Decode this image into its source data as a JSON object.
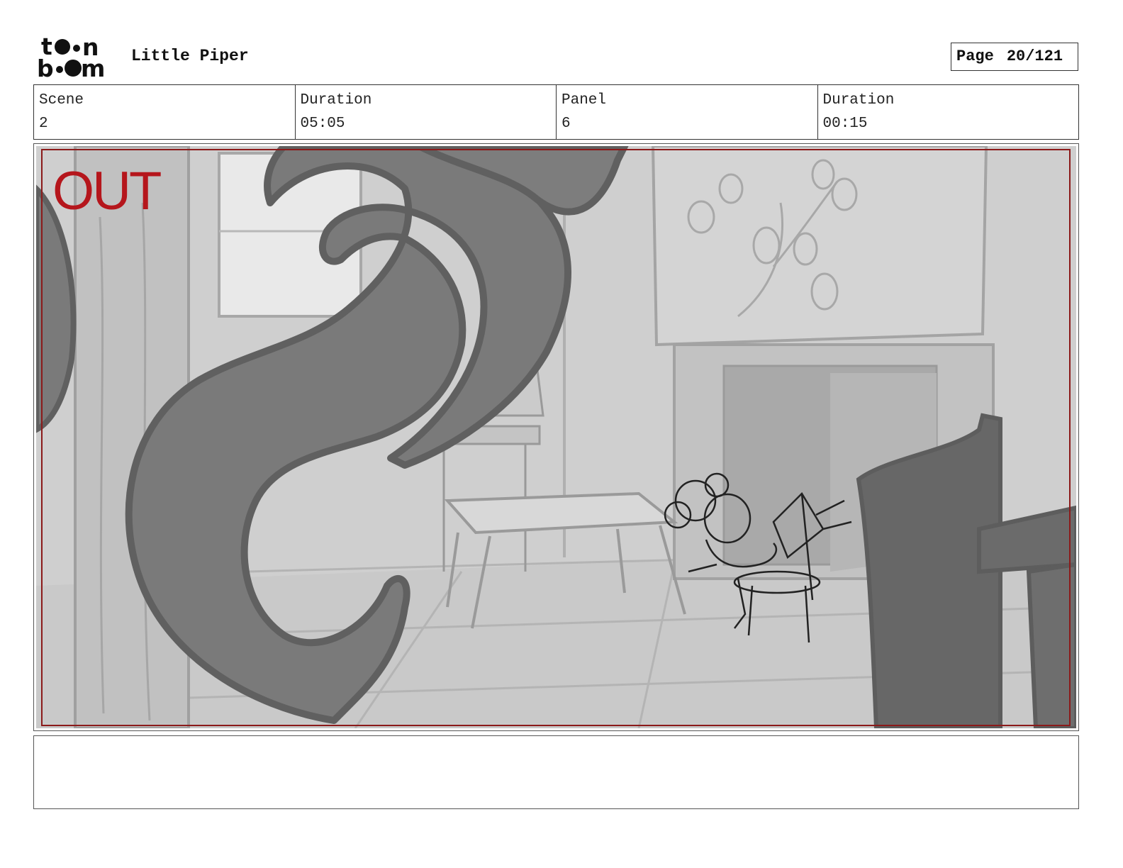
{
  "header": {
    "logo_text": "toon boom",
    "project_title": "Little Piper",
    "page_label": "Page",
    "page_number": "20/121"
  },
  "info": {
    "scene_label": "Scene",
    "scene_value": "2",
    "scene_duration_label": "Duration",
    "scene_duration_value": "05:05",
    "panel_label": "Panel",
    "panel_value": "6",
    "panel_duration_label": "Duration",
    "panel_duration_value": "00:15"
  },
  "panel": {
    "overlay_text": "OUT",
    "overlay_color": "#b5161c",
    "safe_frame_color": "#8b1a1a"
  },
  "notes": {
    "text": ""
  }
}
